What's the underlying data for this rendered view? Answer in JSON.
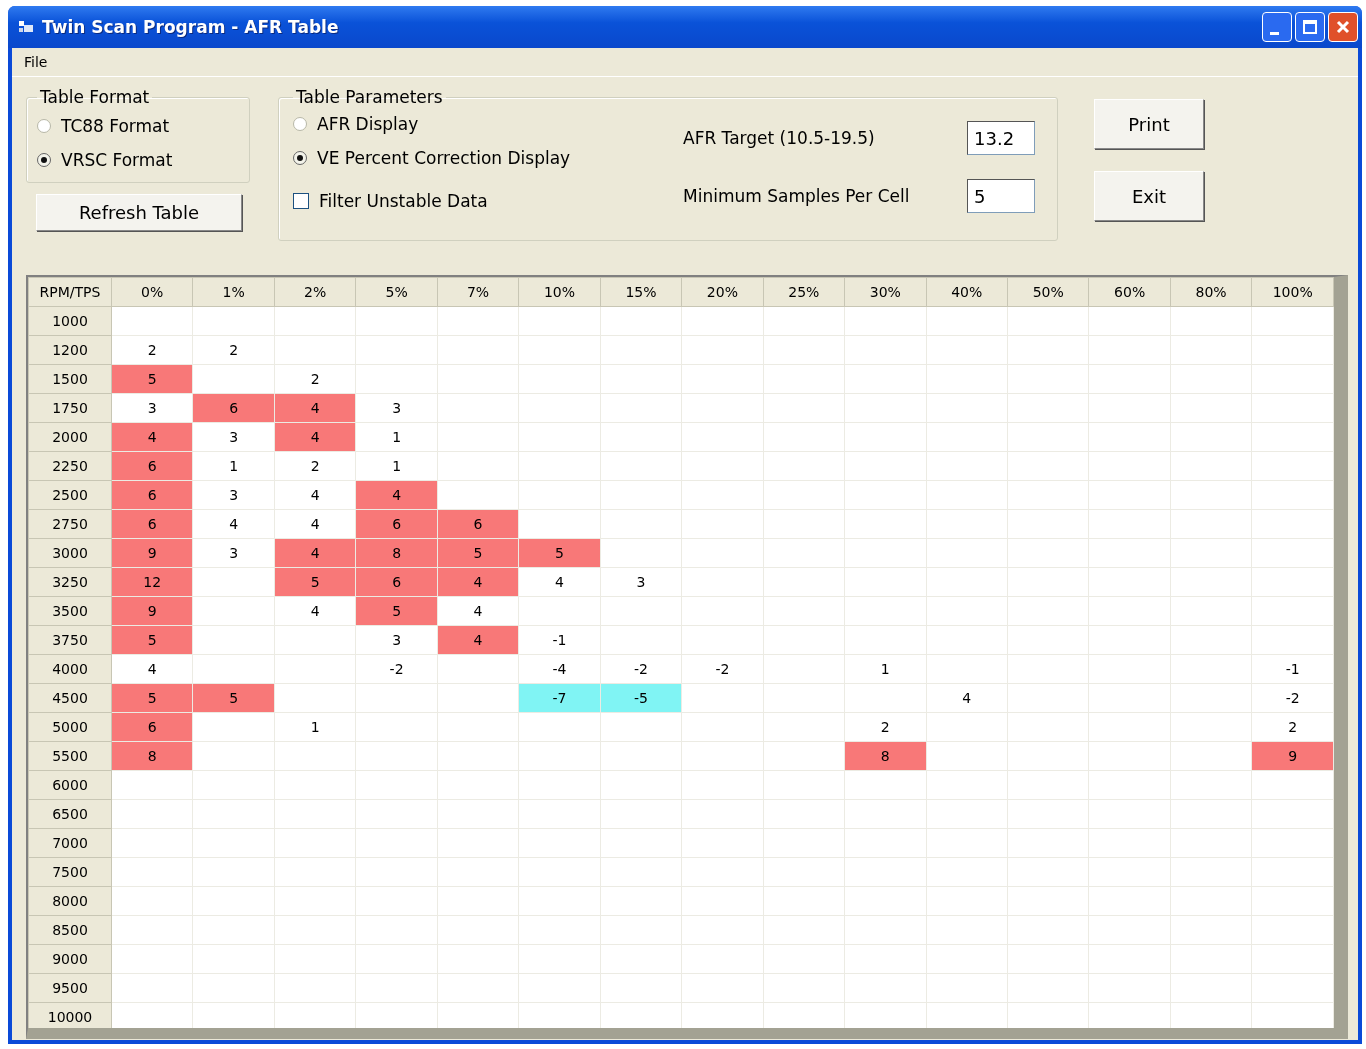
{
  "window": {
    "title": "Twin Scan Program - AFR Table"
  },
  "menu": [
    "File"
  ],
  "table_format": {
    "title": "Table Format",
    "options": [
      {
        "label": "TC88 Format",
        "selected": false
      },
      {
        "label": "VRSC Format",
        "selected": true
      }
    ]
  },
  "refresh_button": "Refresh Table",
  "table_parameters": {
    "title": "Table Parameters",
    "display_options": [
      {
        "label": "AFR Display",
        "selected": false
      },
      {
        "label": "VE Percent Correction Display",
        "selected": true
      }
    ],
    "filter": {
      "label": "Filter Unstable Data",
      "checked": false
    },
    "fields": [
      {
        "label": "AFR Target (10.5-19.5)",
        "value": "13.2"
      },
      {
        "label": "Minimum Samples Per Cell",
        "value": "5"
      }
    ]
  },
  "buttons": [
    "Print",
    "Exit"
  ],
  "table": {
    "corner": "RPM/TPS",
    "columns": [
      "0%",
      "1%",
      "2%",
      "5%",
      "7%",
      "10%",
      "15%",
      "20%",
      "25%",
      "30%",
      "40%",
      "50%",
      "60%",
      "80%",
      "100%"
    ],
    "rows": [
      {
        "rpm": "1000",
        "cells": []
      },
      {
        "rpm": "1200",
        "cells": [
          {
            "text": "2"
          },
          {
            "text": "2"
          }
        ]
      },
      {
        "rpm": "1500",
        "cells": [
          {
            "text": "5",
            "color": "#f87878"
          },
          null,
          {
            "text": "2"
          }
        ]
      },
      {
        "rpm": "1750",
        "cells": [
          {
            "text": "3"
          },
          {
            "text": "6",
            "color": "#f87878"
          },
          {
            "text": "4",
            "color": "#f87878"
          },
          {
            "text": "3"
          }
        ]
      },
      {
        "rpm": "2000",
        "cells": [
          {
            "text": "4",
            "color": "#f87878"
          },
          {
            "text": "3"
          },
          {
            "text": "4",
            "color": "#f87878"
          },
          {
            "text": "1"
          }
        ]
      },
      {
        "rpm": "2250",
        "cells": [
          {
            "text": "6",
            "color": "#f87878"
          },
          {
            "text": "1"
          },
          {
            "text": "2"
          },
          {
            "text": "1"
          }
        ]
      },
      {
        "rpm": "2500",
        "cells": [
          {
            "text": "6",
            "color": "#f87878"
          },
          {
            "text": "3"
          },
          {
            "text": "4"
          },
          {
            "text": "4",
            "color": "#f87878"
          }
        ]
      },
      {
        "rpm": "2750",
        "cells": [
          {
            "text": "6",
            "color": "#f87878"
          },
          {
            "text": "4"
          },
          {
            "text": "4"
          },
          {
            "text": "6",
            "color": "#f87878"
          },
          {
            "text": "6",
            "color": "#f87878"
          }
        ]
      },
      {
        "rpm": "3000",
        "cells": [
          {
            "text": "9",
            "color": "#f87878"
          },
          {
            "text": "3"
          },
          {
            "text": "4",
            "color": "#f87878"
          },
          {
            "text": "8",
            "color": "#f87878"
          },
          {
            "text": "5",
            "color": "#f87878"
          },
          {
            "text": "5",
            "color": "#f87878"
          }
        ]
      },
      {
        "rpm": "3250",
        "cells": [
          {
            "text": "12",
            "color": "#f87878"
          },
          null,
          {
            "text": "5",
            "color": "#f87878"
          },
          {
            "text": "6",
            "color": "#f87878"
          },
          {
            "text": "4",
            "color": "#f87878"
          },
          {
            "text": "4"
          },
          {
            "text": "3"
          }
        ]
      },
      {
        "rpm": "3500",
        "cells": [
          {
            "text": "9",
            "color": "#f87878"
          },
          null,
          {
            "text": "4"
          },
          {
            "text": "5",
            "color": "#f87878"
          },
          {
            "text": "4"
          }
        ]
      },
      {
        "rpm": "3750",
        "cells": [
          {
            "text": "5",
            "color": "#f87878"
          },
          null,
          null,
          {
            "text": "3"
          },
          {
            "text": "4",
            "color": "#f87878"
          },
          {
            "text": "-1"
          }
        ]
      },
      {
        "rpm": "4000",
        "cells": [
          {
            "text": "4"
          },
          null,
          null,
          {
            "text": "-2"
          },
          null,
          {
            "text": "-4"
          },
          {
            "text": "-2"
          },
          {
            "text": "-2"
          },
          null,
          {
            "text": "1"
          },
          null,
          null,
          null,
          null,
          {
            "text": "-1"
          }
        ]
      },
      {
        "rpm": "4500",
        "cells": [
          {
            "text": "5",
            "color": "#f87878"
          },
          {
            "text": "5",
            "color": "#f87878"
          },
          null,
          null,
          null,
          {
            "text": "-7",
            "color": "#80f4f4"
          },
          {
            "text": "-5",
            "color": "#80f4f4"
          },
          null,
          null,
          null,
          {
            "text": "4"
          },
          null,
          null,
          null,
          {
            "text": "-2"
          }
        ]
      },
      {
        "rpm": "5000",
        "cells": [
          {
            "text": "6",
            "color": "#f87878"
          },
          null,
          {
            "text": "1"
          },
          null,
          null,
          null,
          null,
          null,
          null,
          {
            "text": "2"
          },
          null,
          null,
          null,
          null,
          {
            "text": "2"
          }
        ]
      },
      {
        "rpm": "5500",
        "cells": [
          {
            "text": "8",
            "color": "#f87878"
          },
          null,
          null,
          null,
          null,
          null,
          null,
          null,
          null,
          {
            "text": "8",
            "color": "#f87878"
          },
          null,
          null,
          null,
          null,
          {
            "text": "9",
            "color": "#f87878"
          }
        ]
      },
      {
        "rpm": "6000",
        "cells": []
      },
      {
        "rpm": "6500",
        "cells": []
      },
      {
        "rpm": "7000",
        "cells": []
      },
      {
        "rpm": "7500",
        "cells": []
      },
      {
        "rpm": "8000",
        "cells": []
      },
      {
        "rpm": "8500",
        "cells": []
      },
      {
        "rpm": "9000",
        "cells": []
      },
      {
        "rpm": "9500",
        "cells": []
      },
      {
        "rpm": "10000",
        "cells": []
      }
    ]
  }
}
